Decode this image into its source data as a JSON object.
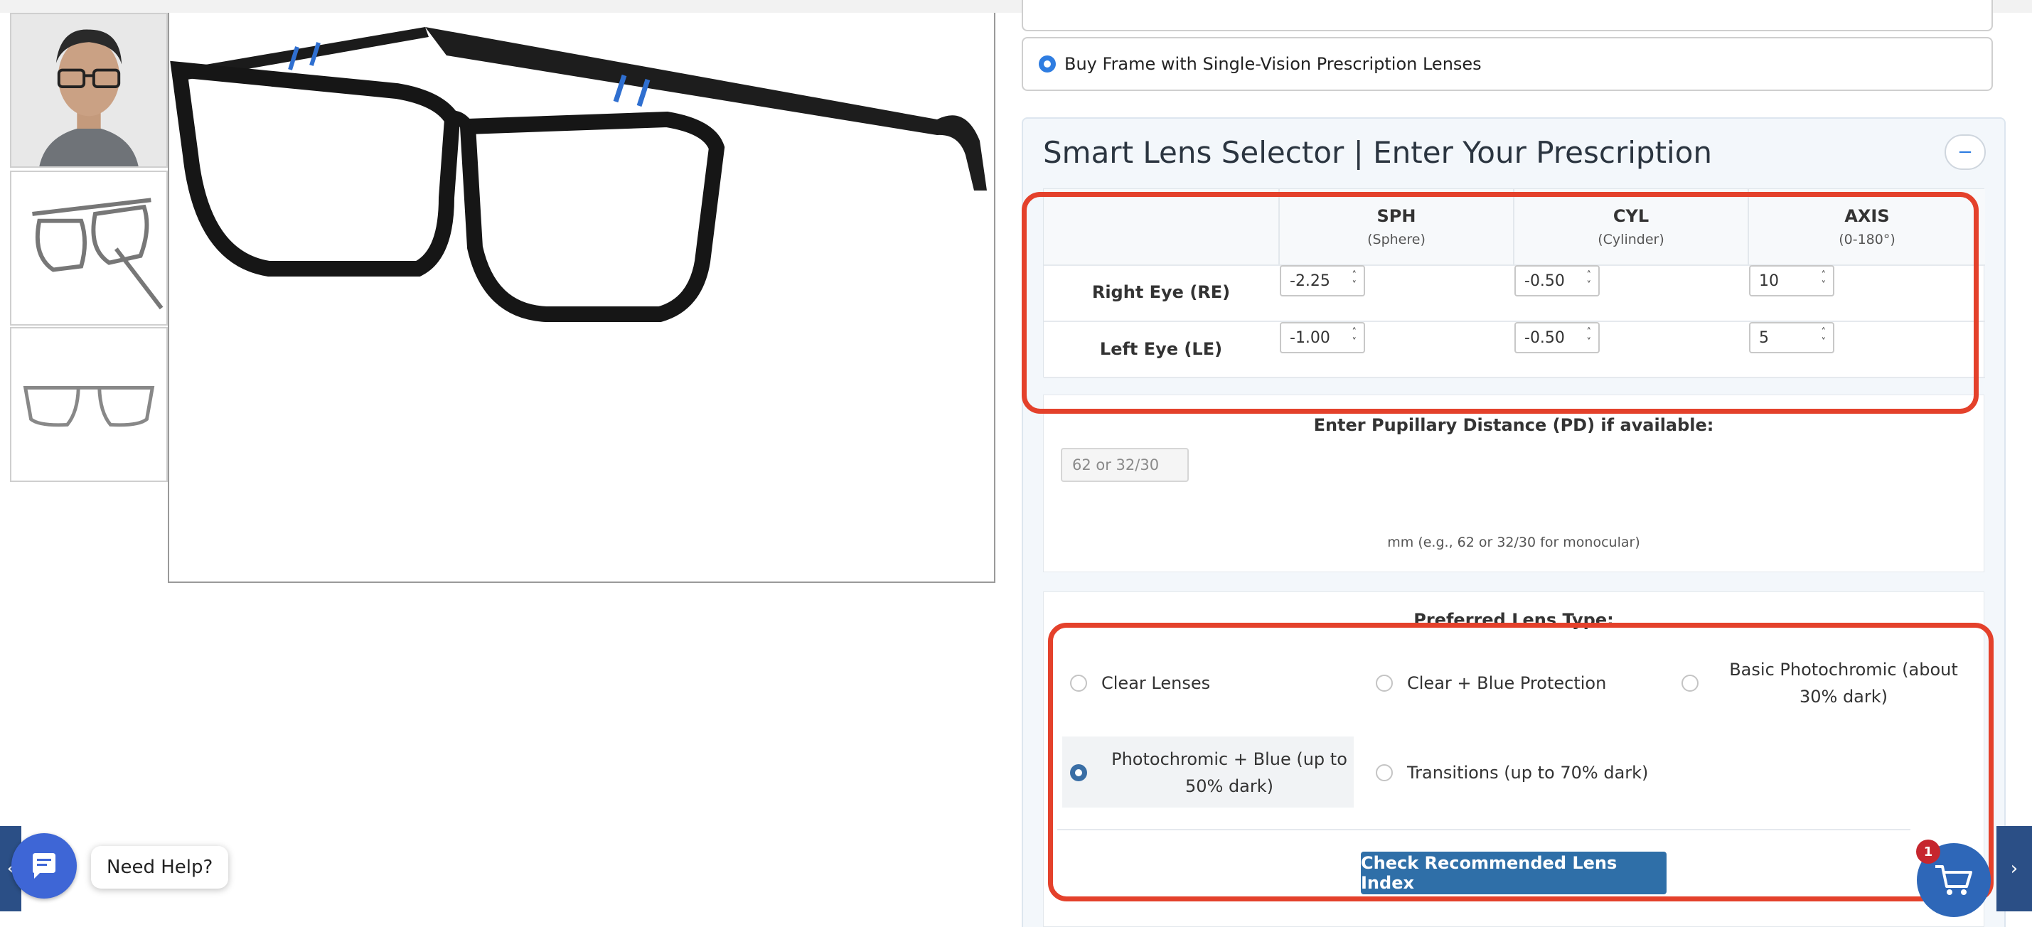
{
  "options": {
    "selected_label": "Buy Frame with Single-Vision Prescription Lenses"
  },
  "panel": {
    "title": "Smart Lens Selector | Enter Your Prescription",
    "collapse_symbol": "−"
  },
  "prescription": {
    "columns": [
      {
        "name": "SPH",
        "sub": "(Sphere)"
      },
      {
        "name": "CYL",
        "sub": "(Cylinder)"
      },
      {
        "name": "AXIS",
        "sub": "(0-180°)"
      }
    ],
    "rows": [
      {
        "label": "Right Eye (RE)",
        "sph": "-2.25",
        "cyl": "-0.50",
        "axis": "10"
      },
      {
        "label": "Left Eye (LE)",
        "sph": "-1.00",
        "cyl": "-0.50",
        "axis": "5"
      }
    ]
  },
  "pd": {
    "heading": "Enter Pupillary Distance (PD) if available:",
    "placeholder": "62 or 32/30",
    "help": "mm (e.g., 62 or 32/30 for monocular)"
  },
  "lens_type": {
    "heading": "Preferred Lens Type:",
    "options": [
      {
        "label": "Clear Lenses",
        "selected": false
      },
      {
        "label": "Clear + Blue Protection",
        "selected": false
      },
      {
        "label": "Basic Photochromic (about 30% dark)",
        "selected": false
      },
      {
        "label": "Photochromic + Blue (up to 50% dark)",
        "selected": true
      },
      {
        "label": "Transitions (up to 70% dark)",
        "selected": false
      }
    ]
  },
  "check_button": "Check Recommended Lens Index",
  "chat": {
    "label": "Need Help?"
  },
  "cart": {
    "count": "1"
  },
  "nav": {
    "prev": "‹",
    "next": "›"
  },
  "colors": {
    "accent": "#2f7de1",
    "button": "#2f6fa8",
    "highlight": "#e4412b",
    "badge": "#c6262e"
  },
  "icons": [
    "chat-icon",
    "cart-icon",
    "chevron-left-icon",
    "chevron-right-icon"
  ]
}
